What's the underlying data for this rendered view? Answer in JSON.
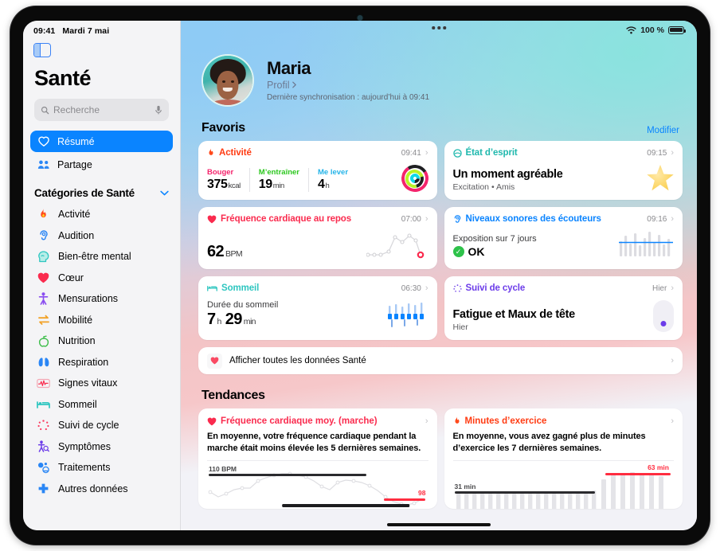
{
  "status": {
    "time": "09:41",
    "date": "Mardi 7 mai",
    "wifi": "wifi-icon",
    "battery_pct": "100 %"
  },
  "sidebar": {
    "toggle": "sidebar-toggle-icon",
    "app_title": "Santé",
    "search": {
      "placeholder": "Recherche",
      "icon": "search-icon",
      "mic": "microphone-icon"
    },
    "nav": [
      {
        "label": "Résumé",
        "icon": "heart-icon",
        "active": true
      },
      {
        "label": "Partage",
        "icon": "people-icon",
        "active": false
      }
    ],
    "section_title": "Catégories de Santé",
    "section_chevron": "chevron-down-icon",
    "categories": [
      {
        "label": "Activité",
        "icon": "flame-icon",
        "color": "#ff4a1c"
      },
      {
        "label": "Audition",
        "icon": "ear-icon",
        "color": "#2a86f5"
      },
      {
        "label": "Bien-être mental",
        "icon": "head-icon",
        "color": "#2ec6c0"
      },
      {
        "label": "Cœur",
        "icon": "heart-icon",
        "color": "#fa2b4e"
      },
      {
        "label": "Mensurations",
        "icon": "body-icon",
        "color": "#8a4df0"
      },
      {
        "label": "Mobilité",
        "icon": "mobility-icon",
        "color": "#f2a227"
      },
      {
        "label": "Nutrition",
        "icon": "apple-icon",
        "color": "#3dbd4a"
      },
      {
        "label": "Respiration",
        "icon": "lungs-icon",
        "color": "#2a86f5"
      },
      {
        "label": "Signes vitaux",
        "icon": "waveform-icon",
        "color": "#fa2b4e"
      },
      {
        "label": "Sommeil",
        "icon": "bed-icon",
        "color": "#2ec6c0"
      },
      {
        "label": "Suivi de cycle",
        "icon": "cycle-icon",
        "color": "#fa3a5e"
      },
      {
        "label": "Symptômes",
        "icon": "symptoms-icon",
        "color": "#6c3ce9"
      },
      {
        "label": "Traitements",
        "icon": "pills-icon",
        "color": "#2a86f5"
      },
      {
        "label": "Autres données",
        "icon": "plus-cross-icon",
        "color": "#2a86f5"
      }
    ]
  },
  "profile": {
    "name": "Maria",
    "link": "Profil",
    "link_chevron": "chevron-right-icon",
    "sync": "Dernière synchronisation : aujourd’hui à 09:41",
    "avatar": "avatar"
  },
  "favorites": {
    "title": "Favoris",
    "edit": "Modifier",
    "cards": [
      {
        "name": "activity",
        "title": "Activité",
        "icon": "flame-icon",
        "color": "#ff3b12",
        "time": "09:41",
        "metrics": [
          {
            "label": "Bouger",
            "color": "#f4246c",
            "value": "375",
            "unit": "kcal"
          },
          {
            "label": "M’entraîner",
            "color": "#4cd527",
            "value": "19",
            "unit": "min"
          },
          {
            "label": "Me lever",
            "color": "#25c3e8",
            "value": "4",
            "unit": "h"
          }
        ],
        "graphic": "activity-rings"
      },
      {
        "name": "state-of-mind",
        "title": "État d’esprit",
        "icon": "mood-icon",
        "color": "#1fb8ad",
        "time": "09:15",
        "headline": "Un moment agréable",
        "subline": "Excitation • Amis",
        "graphic": "mood-star"
      },
      {
        "name": "resting-heart-rate",
        "title": "Fréquence cardiaque au repos",
        "icon": "heart-icon",
        "color": "#fa2b4e",
        "time": "07:00",
        "value": "62",
        "unit": "BPM",
        "graphic": "heart-rate-sparkline"
      },
      {
        "name": "headphone-levels",
        "title": "Niveaux sonores des écouteurs",
        "icon": "ear-icon",
        "color": "#0a84ff",
        "time": "09:16",
        "caption": "Exposition sur 7 jours",
        "status": "OK",
        "status_icon": "check-badge-icon",
        "graphic": "audio-levels-bars"
      },
      {
        "name": "sleep",
        "title": "Sommeil",
        "icon": "bed-icon",
        "color": "#2ec6c0",
        "time": "06:30",
        "caption": "Durée du sommeil",
        "value_h": "7",
        "unit_h": "h",
        "value_m": "29",
        "unit_m": "min",
        "graphic": "sleep-bars"
      },
      {
        "name": "cycle-tracking",
        "title": "Suivi de cycle",
        "icon": "cycle-icon",
        "color": "#6c3ce9",
        "time": "Hier",
        "headline": "Fatigue et Maux de tête",
        "subline": "Hier",
        "graphic": "cycle-pill"
      }
    ],
    "show_all": {
      "label": "Afficher toutes les données Santé",
      "icon": "heart-icon",
      "chevron": "chevron-right-icon"
    }
  },
  "trends": {
    "title": "Tendances",
    "cards": [
      {
        "name": "walking-heart-rate-trend",
        "title": "Fréquence cardiaque moy. (marche)",
        "icon": "heart-icon",
        "color": "#fa2b4e",
        "description": "En moyenne, votre fréquence cardiaque pendant la marche était moins élevée les 5 dernières semaines.",
        "baseline_label": "110 BPM",
        "current_label": "98"
      },
      {
        "name": "exercise-minutes-trend",
        "title": "Minutes d’exercice",
        "icon": "flame-icon",
        "color": "#ff3b12",
        "description": "En moyenne, vous avez gagné plus de minutes d’exercice les 7 dernières semaines.",
        "baseline_label": "31 min",
        "current_label": "63 min"
      }
    ]
  },
  "chart_data": [
    {
      "type": "line",
      "name": "walking-heart-rate",
      "title": "Fréquence cardiaque moy. (marche)",
      "ylabel": "BPM",
      "baseline": 110,
      "current": 98,
      "values": [
        96,
        88,
        92,
        100,
        104,
        103,
        110,
        113,
        116,
        118,
        119,
        117,
        114,
        110,
        104,
        100,
        107,
        111,
        110,
        108,
        106,
        100,
        92,
        86,
        83,
        82,
        84,
        88
      ],
      "ylim": [
        78,
        122
      ],
      "grid": false
    },
    {
      "type": "bar",
      "name": "exercise-minutes",
      "title": "Minutes d’exercice",
      "ylabel": "min",
      "baseline": 31,
      "current": 63,
      "values": [
        31,
        30,
        32,
        31,
        30,
        32,
        31,
        30,
        31,
        32,
        30,
        31,
        31,
        30,
        32,
        31,
        30,
        31,
        45,
        58,
        62,
        63,
        60,
        61,
        58,
        55
      ],
      "ylim": [
        0,
        70
      ],
      "grid": false
    }
  ]
}
